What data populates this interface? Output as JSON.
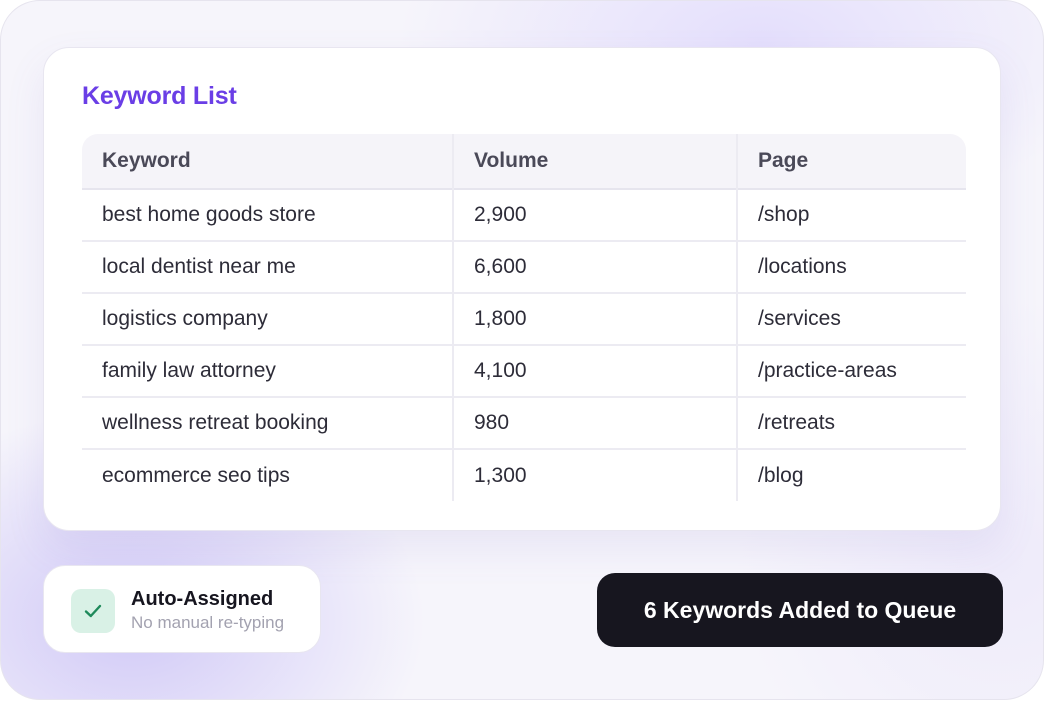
{
  "card": {
    "title": "Keyword List",
    "columns": [
      "Keyword",
      "Volume",
      "Page"
    ],
    "rows": [
      {
        "keyword": "best home goods store",
        "volume": "2,900",
        "page": "/shop"
      },
      {
        "keyword": "local dentist near me",
        "volume": "6,600",
        "page": "/locations"
      },
      {
        "keyword": "logistics company",
        "volume": "1,800",
        "page": "/services"
      },
      {
        "keyword": "family law attorney",
        "volume": "4,100",
        "page": "/practice-areas"
      },
      {
        "keyword": "wellness retreat booking",
        "volume": "980",
        "page": "/retreats"
      },
      {
        "keyword": "ecommerce seo tips",
        "volume": "1,300",
        "page": "/blog"
      }
    ]
  },
  "status": {
    "icon": "check-icon",
    "title": "Auto-Assigned",
    "subtitle": "No manual re-typing"
  },
  "queue_button": {
    "label": "6 Keywords Added to Queue"
  },
  "colors": {
    "accent": "#6a3ee6",
    "button_bg": "#17161f",
    "check_bg": "#d9f1e6",
    "check": "#1f8a5b"
  }
}
